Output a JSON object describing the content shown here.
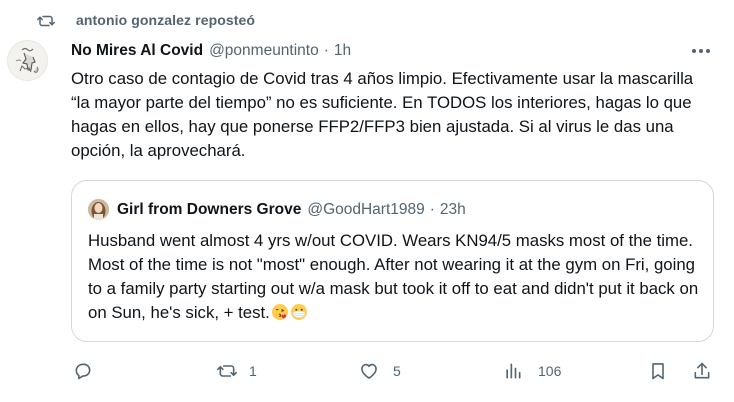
{
  "repost": {
    "text": "antonio gonzalez reposteó",
    "icon": "repost-icon"
  },
  "tweet": {
    "author_name": "No Mires Al Covid",
    "handle": "@ponmeuntinto",
    "separator": "·",
    "time": "1h",
    "text": "Otro caso de contagio de Covid tras 4 años limpio. Efectivamente usar la mascarilla “la mayor parte del tiempo” no es suficiente. En TODOS los interiores, hagas lo que hagas en ellos, hay que ponerse FFP2/FFP3 bien ajustada. Si al virus le das una opción, la aprovechará."
  },
  "quote": {
    "author_name": "Girl from Downers Grove",
    "handle": "@GoodHart1989",
    "separator": "·",
    "time": "23h",
    "text": "Husband went almost 4 yrs w/out COVID. Wears KN94/5 masks most of the time. Most of the time is not \"most\" enough. After not wearing it at the gym on Fri, going to a family party starting out w/a mask but took it off to eat and didn't put it back on on Sun, he's sick, + test.",
    "emojis": [
      "face-blowing-kiss-emoji",
      "face-with-medical-mask-emoji"
    ]
  },
  "actions": {
    "reply_count": "",
    "repost_count": "1",
    "like_count": "5",
    "views_count": "106"
  },
  "colors": {
    "text_primary": "#0f1419",
    "text_secondary": "#536471",
    "border": "#cfd9de"
  }
}
